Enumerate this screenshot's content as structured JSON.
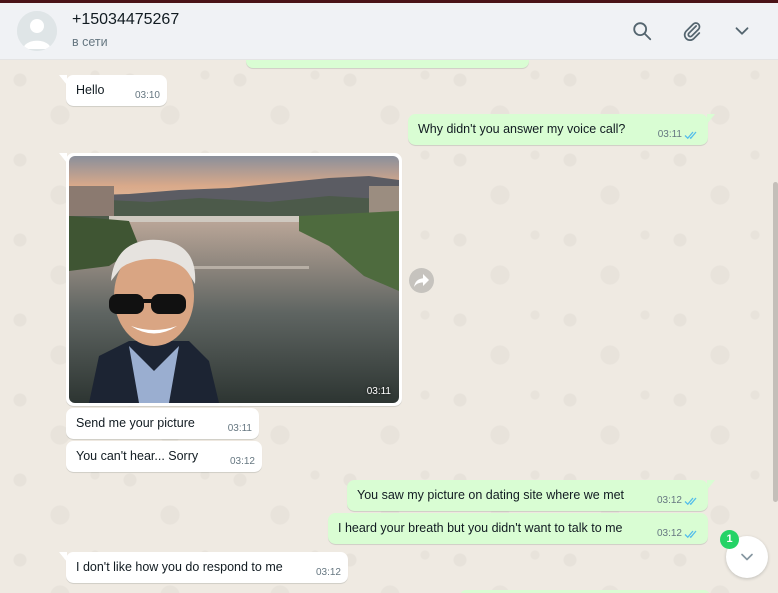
{
  "header": {
    "contact_name": "+15034475267",
    "status": "в сети",
    "icons": [
      "search-icon",
      "paperclip-icon",
      "chevron-down-icon"
    ]
  },
  "messages": [
    {
      "direction": "in",
      "text": "Hello",
      "time": "03:10"
    },
    {
      "direction": "out",
      "text": "Why didn't you answer my voice call?",
      "time": "03:11",
      "status": "read"
    },
    {
      "direction": "in",
      "type": "image",
      "time": "03:11"
    },
    {
      "direction": "in",
      "text": "Send me your picture",
      "time": "03:11"
    },
    {
      "direction": "in",
      "text": "You can't hear... Sorry",
      "time": "03:12"
    },
    {
      "direction": "out",
      "text": "You saw my picture on dating site where we met",
      "time": "03:12",
      "status": "read"
    },
    {
      "direction": "out",
      "text": "I heard your breath but you didn't want to talk to me",
      "time": "03:12",
      "status": "read"
    },
    {
      "direction": "in",
      "text": "I don't like how you do respond to me",
      "time": "03:12"
    }
  ],
  "unread_count": "1",
  "colors": {
    "incoming": "#ffffff",
    "outgoing": "#d9fdd3",
    "tick_read": "#53bdeb",
    "badge": "#25d366"
  }
}
